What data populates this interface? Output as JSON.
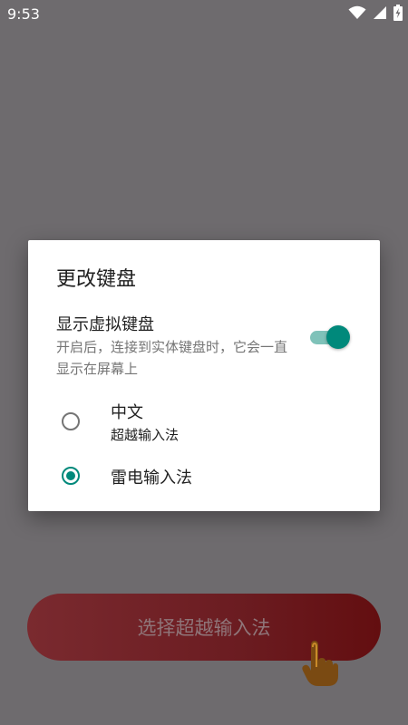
{
  "status_bar": {
    "time": "9:53",
    "icons": [
      "wifi-icon",
      "cellular-signal-icon",
      "battery-charging-icon"
    ]
  },
  "dialog": {
    "title": "更改键盘",
    "virtual_keyboard": {
      "label": "显示虚拟键盘",
      "description": "开启后，连接到实体键盘时，它会一直显示在屏幕上",
      "enabled": true
    },
    "options": [
      {
        "label": "中文",
        "sublabel": "超越输入法",
        "selected": false
      },
      {
        "label": "雷电输入法",
        "sublabel": "",
        "selected": true
      }
    ]
  },
  "background": {
    "button_label": "选择超越输入法",
    "hand_icon": "pointing-hand-icon"
  },
  "colors": {
    "scrim": "#6e6b6e",
    "accent": "#00897b",
    "button": "#6b1c21"
  }
}
